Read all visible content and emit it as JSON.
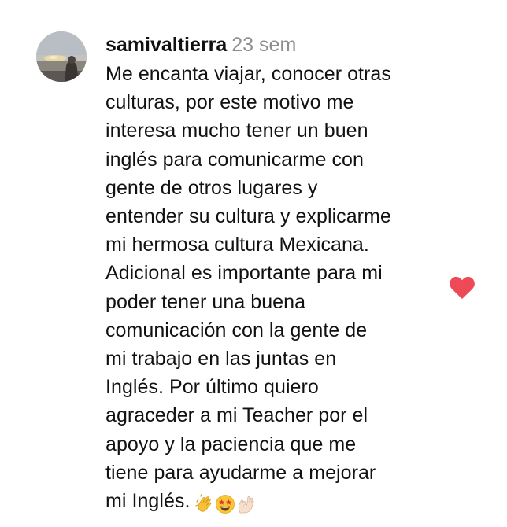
{
  "comment": {
    "username": "samivaltierra",
    "timestamp": "23 sem",
    "text": "Me encanta viajar, conocer otras\nculturas, por este motivo me\ninteresa mucho tener un buen\ninglés para comunicarme con\ngente de otros lugares y\nentender su cultura y explicarme\nmi hermosa cultura Mexicana.\nAdicional es importante para mi\npoder tener una buena\ncomunicación con la gente de\nmi trabajo en las juntas en\nInglés. Por último quiero\nagraceder a mi Teacher por el\napoyo y la paciencia que me\ntiene para ayudarme a mejorar\nmi Inglés.",
    "emojis": [
      "clapping-hands-emoji",
      "star-struck-emoji",
      "ok-hand-emoji"
    ],
    "liked": true,
    "like_color": "#ed4956",
    "avatar": "profile-photo"
  }
}
